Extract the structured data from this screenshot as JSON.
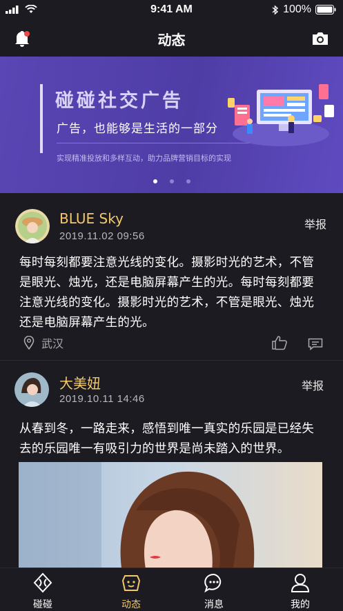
{
  "status": {
    "time": "9:41 AM",
    "battery": "100%"
  },
  "nav": {
    "title": "动态"
  },
  "banner": {
    "title": "碰碰社交广告",
    "subtitle": "广告，也能够是生活的一部分",
    "small": "实现精准投放和多样互动，助力品牌营销目标的实现",
    "dots": 3,
    "active_dot": 0
  },
  "posts": [
    {
      "name": "BLUE Sky",
      "date": "2019.11.02   09:56",
      "report": "举报",
      "lines": [
        "每时每刻都要注意光线的变化。摄影时光的艺术，不管",
        "是眼光、烛光，还是电脑屏幕产生的光。每时每刻都要",
        "注意光线的变化。摄影时光的艺术，不管是眼光、烛光",
        "还是电脑屏幕产生的光。"
      ],
      "location": "武汉"
    },
    {
      "name": "大美妞",
      "date": "2019.10.11   14:46",
      "report": "举报",
      "lines": [
        "从春到冬，一路走来，感悟到唯一真实的乐园是已经失",
        "去的乐园唯一有吸引力的世界是尚未踏入的世界。"
      ]
    }
  ],
  "tabs": [
    {
      "label": "碰碰",
      "icon": "bump-icon"
    },
    {
      "label": "动态",
      "icon": "moments-icon"
    },
    {
      "label": "消息",
      "icon": "message-icon"
    },
    {
      "label": "我的",
      "icon": "profile-icon"
    }
  ],
  "colors": {
    "accent": "#f3c96a",
    "background": "#1c1b21",
    "banner": "#5446ad"
  }
}
